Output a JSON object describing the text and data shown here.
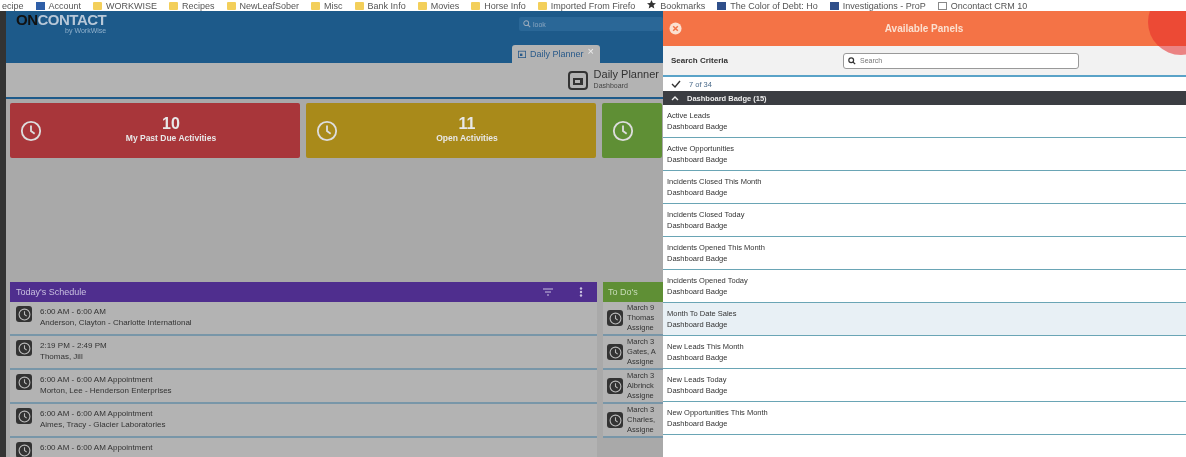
{
  "bookmarks": [
    {
      "label": "ecipe",
      "kind": "none"
    },
    {
      "label": "Account",
      "kind": "app"
    },
    {
      "label": "WORKWISE",
      "kind": "folder"
    },
    {
      "label": "Recipes",
      "kind": "folder"
    },
    {
      "label": "NewLeafSober",
      "kind": "folder"
    },
    {
      "label": "Misc",
      "kind": "folder"
    },
    {
      "label": "Bank Info",
      "kind": "folder"
    },
    {
      "label": "Movies",
      "kind": "folder"
    },
    {
      "label": "Horse Info",
      "kind": "folder"
    },
    {
      "label": "Imported From Firefo",
      "kind": "folder"
    },
    {
      "label": "Bookmarks",
      "kind": "star"
    },
    {
      "label": "The Color of Debt: Ho",
      "kind": "page"
    },
    {
      "label": "Investigations - ProP",
      "kind": "page"
    },
    {
      "label": "Oncontact CRM 10",
      "kind": "blank"
    }
  ],
  "app": {
    "logo": {
      "strong": "ON",
      "rest": "CONTACT",
      "tagline": "by WorkWise"
    },
    "search": {
      "placeholder": "look"
    },
    "tabs": [
      {
        "label": "Daily Planner",
        "close": "×",
        "selected": true
      }
    ],
    "page_header": {
      "title": "Daily Planner",
      "subtitle": "Dashboard"
    },
    "badges": [
      {
        "count": "10",
        "label": "My Past Due Activities",
        "color": "#a8363a"
      },
      {
        "count": "11",
        "label": "Open Activities",
        "color": "#a98a1a"
      },
      {
        "color": "#5f8f35"
      }
    ],
    "schedule": {
      "title": "Today's Schedule",
      "items": [
        {
          "line1": "6:00 AM - 6:00 AM",
          "line2": "Anderson, Clayton  - Charlotte International"
        },
        {
          "line1": "2:19 PM - 2:49 PM",
          "line2": "Thomas, Jill"
        },
        {
          "line1": "6:00 AM - 6:00 AM Appointment",
          "line2": "Morton, Lee  - Henderson Enterprises"
        },
        {
          "line1": "6:00 AM - 6:00 AM Appointment",
          "line2": "Aimes, Tracy  - Glacier Laboratories"
        },
        {
          "line1": "6:00 AM - 6:00 AM Appointment"
        }
      ]
    },
    "todos": {
      "title": "To Do's",
      "items": [
        {
          "line1": "March 9",
          "line2": "Thomas",
          "line3": "Assigne"
        },
        {
          "line1": "March 3",
          "line2": "Gates, A",
          "line3": "Assigne"
        },
        {
          "line1": "March 3",
          "line2": "Albrinck",
          "line3": "Assigne"
        },
        {
          "line1": "March 3",
          "line2": "Charles,",
          "line3": "Assigne"
        }
      ]
    }
  },
  "panel": {
    "title": "Available Panels",
    "search_label": "Search Criteria",
    "search": {
      "placeholder": "Search"
    },
    "count": "7 of 34",
    "group": {
      "title": "Dashboard Badge (15)",
      "expanded": true,
      "items": [
        {
          "name": "Active Leads",
          "type": "Dashboard Badge",
          "selected": false
        },
        {
          "name": "Active Opportunities",
          "type": "Dashboard Badge",
          "selected": false
        },
        {
          "name": "Incidents Closed This Month",
          "type": "Dashboard Badge",
          "selected": false
        },
        {
          "name": "Incidents Closed Today",
          "type": "Dashboard Badge",
          "selected": false
        },
        {
          "name": "Incidents Opened This Month",
          "type": "Dashboard Badge",
          "selected": false
        },
        {
          "name": "Incidents Opened Today",
          "type": "Dashboard Badge",
          "selected": false
        },
        {
          "name": "Month To Date Sales",
          "type": "Dashboard Badge",
          "selected": true
        },
        {
          "name": "New Leads This Month",
          "type": "Dashboard Badge",
          "selected": false
        },
        {
          "name": "New Leads Today",
          "type": "Dashboard Badge",
          "selected": false
        },
        {
          "name": "New Opportunities This Month",
          "type": "Dashboard Badge",
          "selected": false
        }
      ]
    }
  }
}
